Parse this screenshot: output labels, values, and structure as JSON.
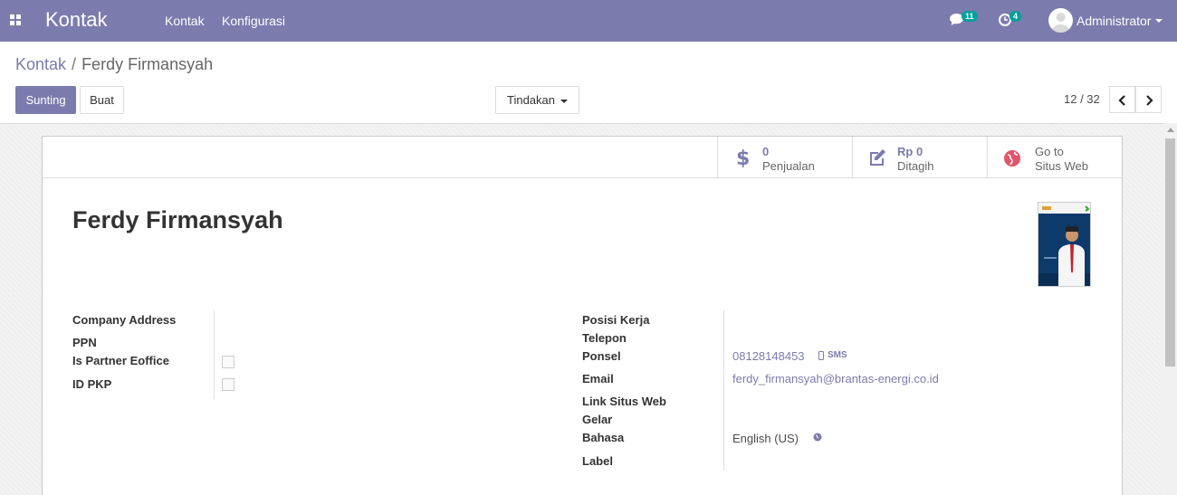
{
  "navbar": {
    "app_title": "Kontak",
    "menu": [
      "Kontak",
      "Konfigurasi"
    ],
    "messages_count": "11",
    "activities_count": "4",
    "user_name": "Administrator"
  },
  "control_panel": {
    "breadcrumb_parent": "Kontak",
    "breadcrumb_current": "Ferdy Firmansyah",
    "edit_label": "Sunting",
    "create_label": "Buat",
    "action_label": "Tindakan",
    "pager": "12 / 32"
  },
  "stat_buttons": {
    "sales_value": "0",
    "sales_label": "Penjualan",
    "invoiced_value": "Rp 0",
    "invoiced_label": "Ditagih",
    "website_line1": "Go to",
    "website_line2": "Situs Web"
  },
  "record": {
    "name": "Ferdy Firmansyah",
    "left_fields": {
      "company_address": "Company Address",
      "ppn": "PPN",
      "is_partner": "Is Partner Eoffice",
      "id_pkp": "ID PKP"
    },
    "right_fields": {
      "job_position": "Posisi Kerja",
      "phone": "Telepon",
      "mobile": "Ponsel",
      "email": "Email",
      "website": "Link Situs Web",
      "title": "Gelar",
      "language": "Bahasa",
      "tags": "Label"
    },
    "values": {
      "mobile": "08128148453",
      "sms": "SMS",
      "email": "ferdy_firmansyah@brantas-energi.co.id",
      "language": "English (US)"
    }
  },
  "colors": {
    "brand": "#7c7bad",
    "badge": "#00a09d"
  }
}
